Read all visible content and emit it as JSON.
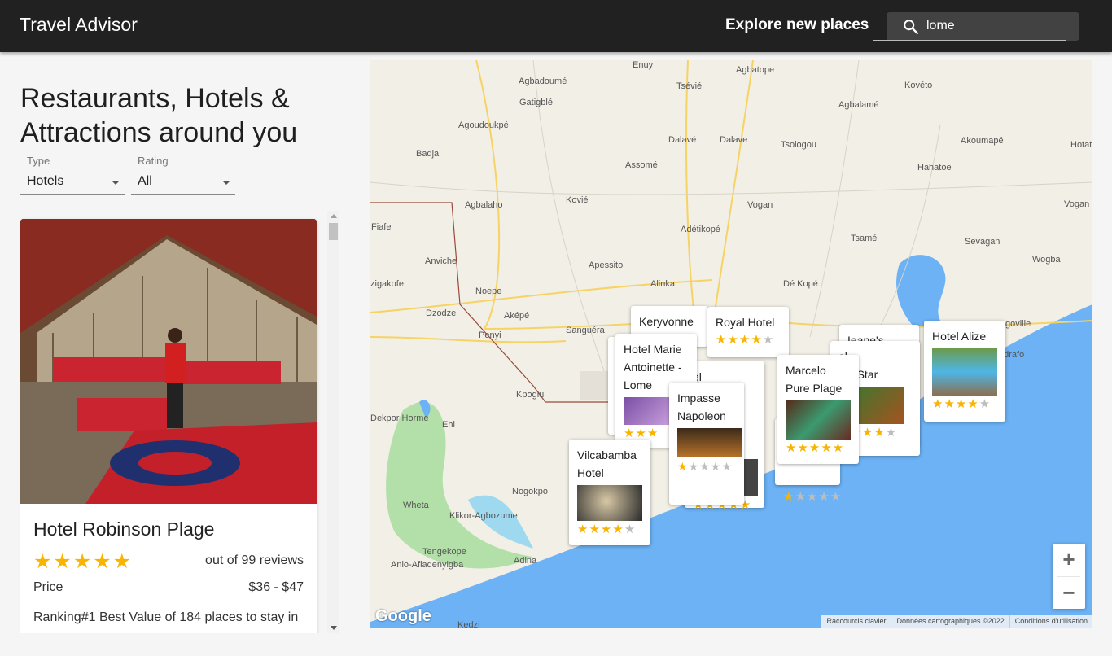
{
  "app": {
    "title": "Travel Advisor",
    "explore": "Explore new places"
  },
  "search": {
    "value": "lome"
  },
  "left": {
    "heading": "Restaurants, Hotels & Attractions around you",
    "type_label": "Type",
    "type_value": "Hotels",
    "rating_label": "Rating",
    "rating_value": "All"
  },
  "card": {
    "title": "Hotel Robinson Plage",
    "stars": "★★★★★",
    "rating": 5,
    "reviews": "out of 99 reviews",
    "price_label": "Price",
    "price_value": "$36 - $47",
    "ranking": "Ranking#1 Best Value of 184 places to stay in"
  },
  "map": {
    "places": [
      "Enuy",
      "Agbatope",
      "Agbadoumé",
      "Tsévié",
      "Kovéto",
      "Gatigblé",
      "Agbalamé",
      "Agoudoukpé",
      "Dalavé",
      "Dalave",
      "Tsologou",
      "Akoumapé",
      "Hotatim",
      "Badja",
      "Assomé",
      "Hahatoe",
      "Agbalaho",
      "Kovié",
      "Vogan",
      "Vogan",
      "Fiafe",
      "Adétikopé",
      "Tsamé",
      "Sevagan",
      "Anviche",
      "Apessito",
      "Wogba",
      "zigakofe",
      "Alinka",
      "Dé Kopé",
      "Noepe",
      "Dzodze",
      "Aképé",
      "Sanguéra",
      "Penyi",
      "Kpoglu",
      "Dekpor Horme",
      "Ehi",
      "Wheta",
      "Nogokpo",
      "Klikor-Agbozume",
      "Tengekope",
      "Anlo-Afiadenyigba",
      "Adina",
      "Kedzi",
      "goville",
      "odrafo"
    ],
    "markers": [
      {
        "name": "Keryvonne",
        "rating": null
      },
      {
        "name": "Royal Hotel",
        "rating": 4
      },
      {
        "name": "Hotel Marie Antoinette - Lome",
        "rating": 3
      },
      {
        "name": "Impasse Napoleon",
        "rating": 1
      },
      {
        "name": "Marcelo Pure Plage",
        "rating": 5
      },
      {
        "name": "Vilcabamba Hotel",
        "rating": 4
      },
      {
        "name": "Hotel Alize",
        "rating": 4
      },
      {
        "name": "Ieane's",
        "rating": null
      },
      {
        "name": "el",
        "rating": null
      },
      {
        "name": "ela Star",
        "rating": 4
      },
      {
        "name": "el",
        "rating": null
      }
    ],
    "extra_ratings": [
      4,
      1,
      4
    ],
    "zoom_in": "+",
    "zoom_out": "−",
    "google": "Google",
    "attrib": [
      "Raccourcis clavier",
      "Données cartographiques ©2022",
      "Conditions d'utilisation"
    ]
  },
  "colors": {
    "appbar": "#212121",
    "star": "#f8b400",
    "sea": "#6cb2f5",
    "land": "#f2efe6"
  }
}
